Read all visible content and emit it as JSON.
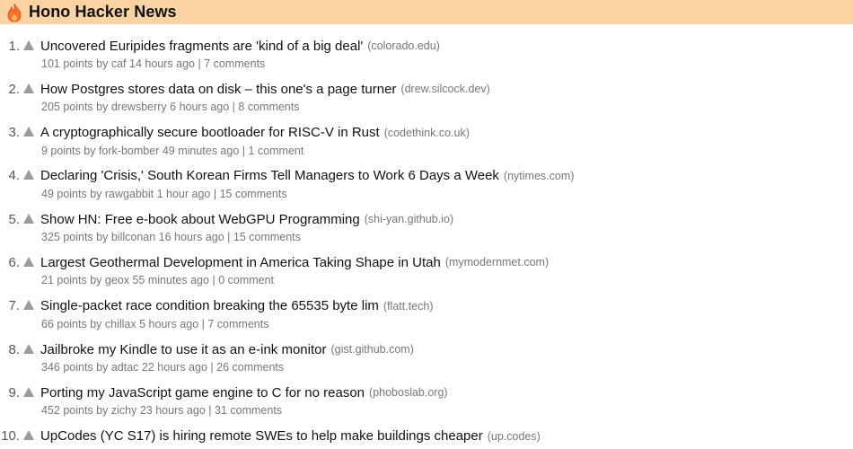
{
  "app": {
    "title": "Hono Hacker News",
    "header_color": "#f9d3a4",
    "logo_icon": "flame-icon"
  },
  "items": [
    {
      "rank": "1.",
      "title": "Uncovered Euripides fragments are 'kind of a big deal'",
      "domain": "(colorado.edu)",
      "score": "101 points",
      "by": "by caf",
      "time": "14 hours ago",
      "sep": "|",
      "comments": "7 comments"
    },
    {
      "rank": "2.",
      "title": "How Postgres stores data on disk – this one's a page turner",
      "domain": "(drew.silcock.dev)",
      "score": "205 points",
      "by": "by drewsberry",
      "time": "6 hours ago",
      "sep": "|",
      "comments": "8 comments"
    },
    {
      "rank": "3.",
      "title": "A cryptographically secure bootloader for RISC-V in Rust",
      "domain": "(codethink.co.uk)",
      "score": "9 points",
      "by": "by fork-bomber",
      "time": "49 minutes ago",
      "sep": "|",
      "comments": "1 comment"
    },
    {
      "rank": "4.",
      "title": "Declaring 'Crisis,' South Korean Firms Tell Managers to Work 6 Days a Week",
      "domain": "(nytimes.com)",
      "score": "49 points",
      "by": "by rawgabbit",
      "time": "1 hour ago",
      "sep": "|",
      "comments": "15 comments"
    },
    {
      "rank": "5.",
      "title": "Show HN: Free e-book about WebGPU Programming",
      "domain": "(shi-yan.github.io)",
      "score": "325 points",
      "by": "by billconan",
      "time": "16 hours ago",
      "sep": "|",
      "comments": "15 comments"
    },
    {
      "rank": "6.",
      "title": "Largest Geothermal Development in America Taking Shape in Utah",
      "domain": "(mymodernmet.com)",
      "score": "21 points",
      "by": "by geox",
      "time": "55 minutes ago",
      "sep": "|",
      "comments": "0 comment"
    },
    {
      "rank": "7.",
      "title": "Single-packet race condition breaking the 65535 byte lim",
      "domain": "(flatt.tech)",
      "score": "66 points",
      "by": "by chillax",
      "time": "5 hours ago",
      "sep": "|",
      "comments": "7 comments"
    },
    {
      "rank": "8.",
      "title": "Jailbroke my Kindle to use it as an e-ink monitor",
      "domain": "(gist.github.com)",
      "score": "346 points",
      "by": "by adtac",
      "time": "22 hours ago",
      "sep": "|",
      "comments": "26 comments"
    },
    {
      "rank": "9.",
      "title": "Porting my JavaScript game engine to C for no reason",
      "domain": "(phoboslab.org)",
      "score": "452 points",
      "by": "by zichy",
      "time": "23 hours ago",
      "sep": "|",
      "comments": "31 comments"
    },
    {
      "rank": "10.",
      "title": "UpCodes (YC S17) is hiring remote SWEs to help make buildings cheaper",
      "domain": "(up.codes)",
      "score": "",
      "by": "",
      "time": "",
      "sep": "",
      "comments": ""
    }
  ]
}
